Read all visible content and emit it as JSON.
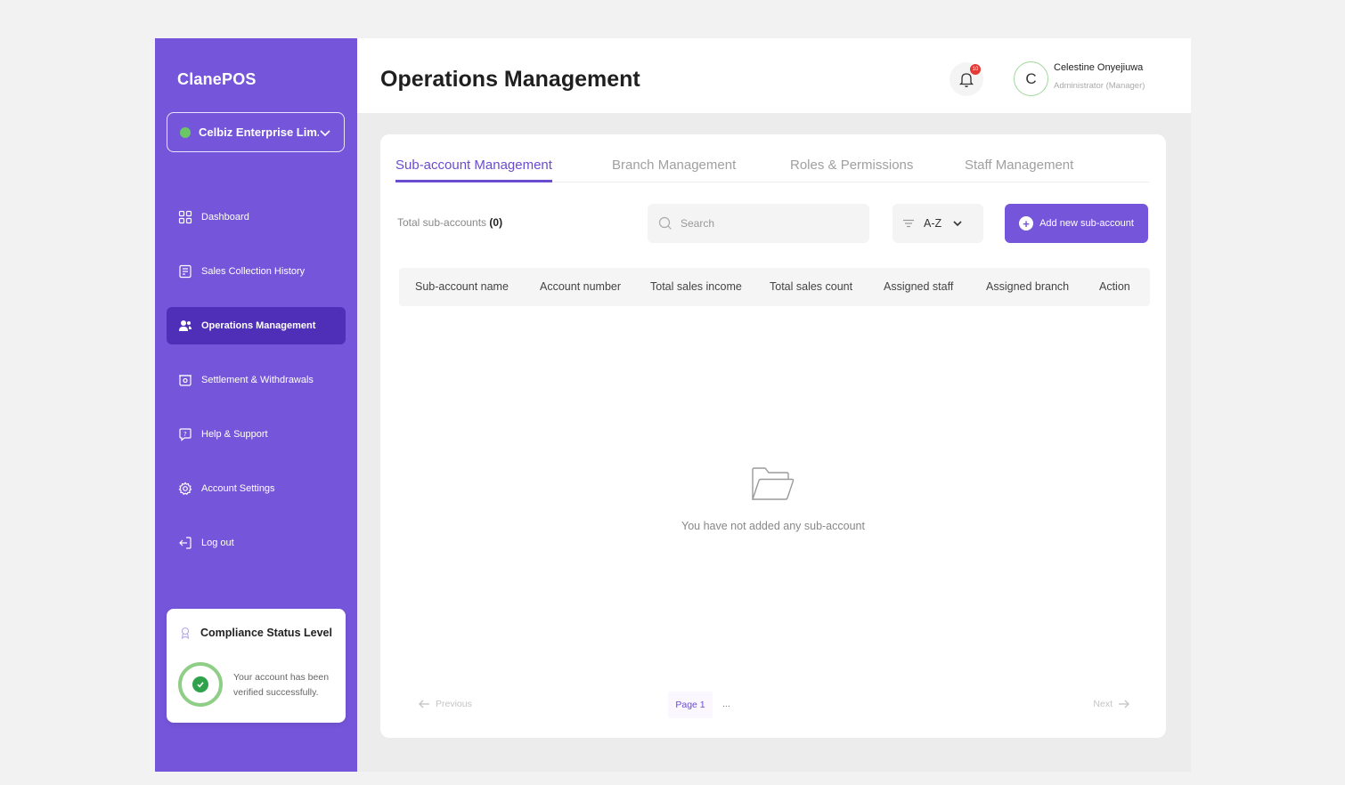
{
  "sidebar": {
    "logo": "ClanePOS",
    "business": "Celbiz Enterprise Lim..",
    "items": [
      {
        "label": "Dashboard",
        "icon": "grid-icon"
      },
      {
        "label": "Sales Collection History",
        "icon": "receipt-icon"
      },
      {
        "label": "Operations Management",
        "icon": "users-icon",
        "active": true
      },
      {
        "label": "Settlement & Withdrawals",
        "icon": "wallet-icon"
      },
      {
        "label": "Help & Support",
        "icon": "help-chat-icon"
      },
      {
        "label": "Account Settings",
        "icon": "gear-icon"
      },
      {
        "label": "Log out",
        "icon": "logout-icon"
      }
    ],
    "compliance": {
      "title": "Compliance Status Level",
      "message": "Your account has been verified successfully."
    }
  },
  "header": {
    "title": "Operations Management",
    "notification_count": "10",
    "user": {
      "initial": "C",
      "name": "Celestine Onyejiuwa",
      "role": "Administrator (Manager)"
    }
  },
  "tabs": [
    {
      "label": "Sub-account Management",
      "active": true
    },
    {
      "label": "Branch Management"
    },
    {
      "label": "Roles & Permissions"
    },
    {
      "label": "Staff Management"
    }
  ],
  "toolbar": {
    "total_label": "Total sub-accounts",
    "total_value": "(0)",
    "search_placeholder": "Search",
    "sort_label": "A-Z",
    "add_button": "Add new sub-account"
  },
  "table": {
    "columns": [
      "Sub-account name",
      "Account number",
      "Total sales income",
      "Total sales count",
      "Assigned staff",
      "Assigned branch",
      "Action"
    ],
    "rows": [],
    "empty_message": "You have not added any sub-account"
  },
  "pagination": {
    "previous": "Previous",
    "page": "Page 1",
    "ellipsis": "...",
    "next": "Next"
  },
  "colors": {
    "brand": "#7555d9",
    "active_nav": "#4f2fb8",
    "success": "#31a24c",
    "notification": "#e53935"
  }
}
